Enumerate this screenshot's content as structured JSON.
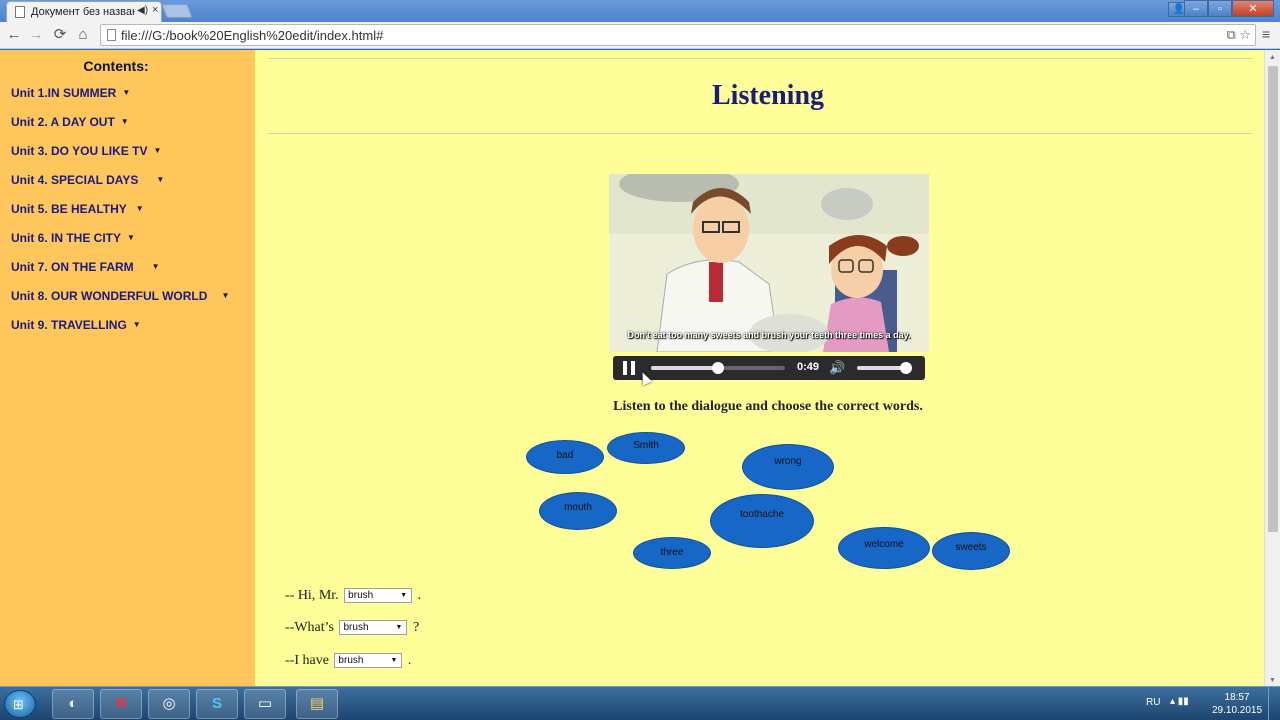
{
  "browser": {
    "tab_title": "Документ без назван",
    "tab_close": "×",
    "url": "file:///G:/book%20English%20edit/index.html#",
    "nav": {
      "back": "←",
      "forward": "→",
      "reload": "⟳",
      "home": "⌂"
    },
    "menu": "≡",
    "window_controls": {
      "minimize": "–",
      "maximize": "▫",
      "close": "✕"
    }
  },
  "sidebar": {
    "title": "Contents:",
    "items": [
      {
        "label": "Unit 1.IN SUMMER"
      },
      {
        "label": "Unit 2. A DAY OUT"
      },
      {
        "label": "Unit 3. DO YOU LIKE TV"
      },
      {
        "label": "Unit 4. SPECIAL DAYS"
      },
      {
        "label": "Unit 5. BE HEALTHY"
      },
      {
        "label": "Unit 6. IN THE CITY"
      },
      {
        "label": "Unit 7. ON THE FARM"
      },
      {
        "label": "Unit 8. OUR WONDERFUL WORLD"
      },
      {
        "label": "Unit 9. TRAVELLING"
      }
    ]
  },
  "main": {
    "heading": "Listening",
    "video": {
      "subtitle": "Don't eat too many sweets and brush your teeth three times a day.",
      "time": "0:49",
      "progress": 0.5,
      "volume": 0.9
    },
    "instruction": "Listen to the dialogue and choose the correct words.",
    "words": [
      "bad",
      "Smith",
      "wrong",
      "mouth",
      "toothache",
      "three",
      "welcome",
      "sweets"
    ],
    "sentences": [
      {
        "before": "-- Hi, Mr.",
        "selected": "brush",
        "after": "."
      },
      {
        "before": "--What’s",
        "selected": "brush",
        "after": "?"
      },
      {
        "before": "--I have",
        "selected": "brush",
        "after": "."
      }
    ]
  },
  "taskbar": {
    "language": "RU",
    "time": "18:57",
    "date": "29.10.2015"
  }
}
